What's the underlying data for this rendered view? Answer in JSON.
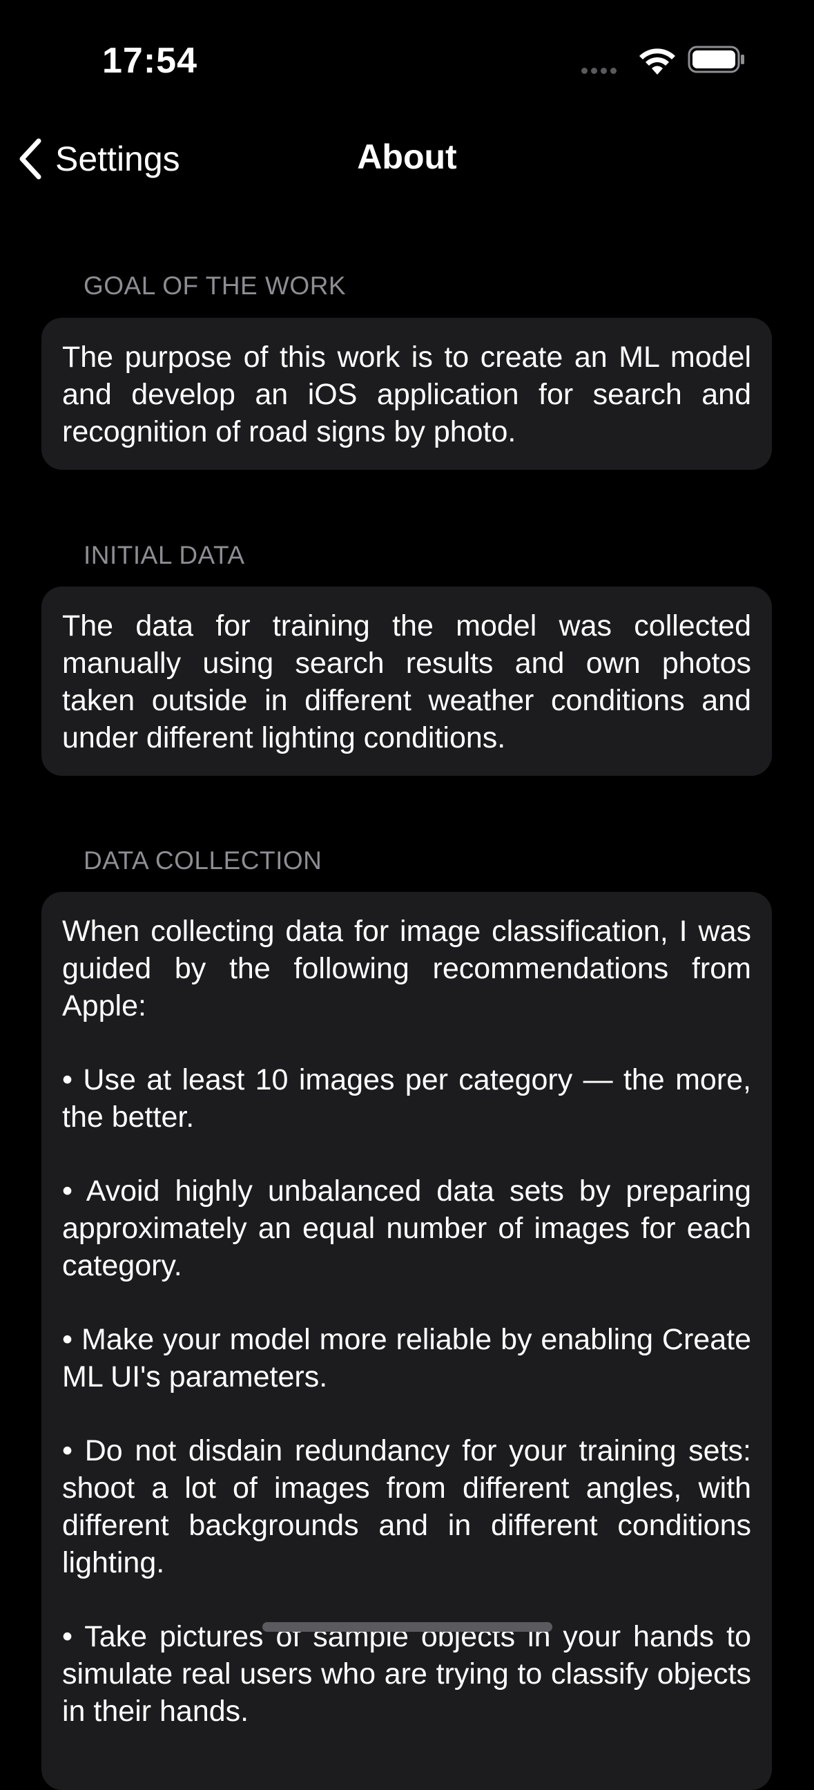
{
  "status_bar": {
    "time": "17:54"
  },
  "nav": {
    "back_label": "Settings",
    "title": "About"
  },
  "sections": [
    {
      "header": "GOAL OF THE WORK",
      "paragraphs": [
        "The purpose of this work is to create an ML model and develop an iOS application for search and recognition of road signs by photo."
      ]
    },
    {
      "header": "INITIAL DATA",
      "paragraphs": [
        "The data for training the model was collected manually using search results and own photos taken outside in different weather conditions and under different lighting conditions."
      ]
    },
    {
      "header": "DATA COLLECTION",
      "paragraphs": [
        "When collecting data for image classification, I was guided by the following recommendations from Apple:",
        "• Use at least 10 images per category — the more, the better.",
        "• Avoid highly unbalanced data sets by preparing approximately an equal number of images for each category.",
        "• Make your model more reliable by enabling Create ML UI's parameters.",
        "• Do not disdain redundancy for your training sets: shoot a lot of images from different angles, with different backgrounds and in different conditions lighting.",
        "• Take pictures of sample objects in your hands to simulate real users who are trying to classify objects in their hands."
      ]
    }
  ]
}
